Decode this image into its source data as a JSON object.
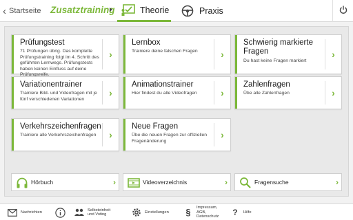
{
  "header": {
    "back_label": "Startseite",
    "section": "Zusatztraining",
    "tabs": [
      {
        "label": "Theorie",
        "icon": "theory-board-icon",
        "active": true
      },
      {
        "label": "Praxis",
        "icon": "steering-wheel-icon",
        "active": false
      }
    ]
  },
  "cards": [
    {
      "title": "Prüfungstest",
      "desc": "71 Prüfungen übrig. Das komplette Prüfungstraining folgt im 4. Schritt des geführten Lernwegs. Prüfungstests haben keinen Einfluss auf deine Prüfungsreife."
    },
    {
      "title": "Lernbox",
      "desc": "Trainiere deine falschen Fragen"
    },
    {
      "title": "Schwierig markierte Fragen",
      "desc": "Du hast keine Fragen markiert"
    },
    {
      "title": "Variationentrainer",
      "desc": "Trainiere Bild- und Videofragen mit je fünf verschiedenen Variationen"
    },
    {
      "title": "Animationstrainer",
      "desc": "Hier findest du alle Videofragen"
    },
    {
      "title": "Zahlenfragen",
      "desc": "Übe alle Zahlenfragen"
    },
    {
      "title": "Verkehrszeichenfragen",
      "desc": "Trainiere alle Verkehrszeichenfragen"
    },
    {
      "title": "Neue Fragen",
      "desc": "Übe die neuen Fragen zur offiziellen Fragenänderung"
    }
  ],
  "bottom_cards": [
    {
      "label": "Hörbuch",
      "icon": "headphones-icon"
    },
    {
      "label": "Videoverzeichnis",
      "icon": "video-icon"
    },
    {
      "label": "Fragensuche",
      "icon": "search-icon"
    }
  ],
  "footer": [
    {
      "label": "Nachrichten",
      "icon": "mail-icon"
    },
    {
      "label": "",
      "icon": "info-icon"
    },
    {
      "label1": "Selbsteinheit",
      "label2": "und Voting",
      "icon": "people-icon"
    },
    {
      "label": "Einstellungen",
      "icon": "gear-icon"
    },
    {
      "label1": "Impressum,",
      "label2": "AGB,",
      "label3": "Datenschutz",
      "icon": "paragraph-icon"
    },
    {
      "label": "Hilfe",
      "icon": "help-icon"
    }
  ],
  "colors": {
    "accent": "#7cb83a",
    "background": "#f2f2f2",
    "panel": "#e9e9e9"
  },
  "arrow_glyph": "›",
  "back_glyph": "‹"
}
